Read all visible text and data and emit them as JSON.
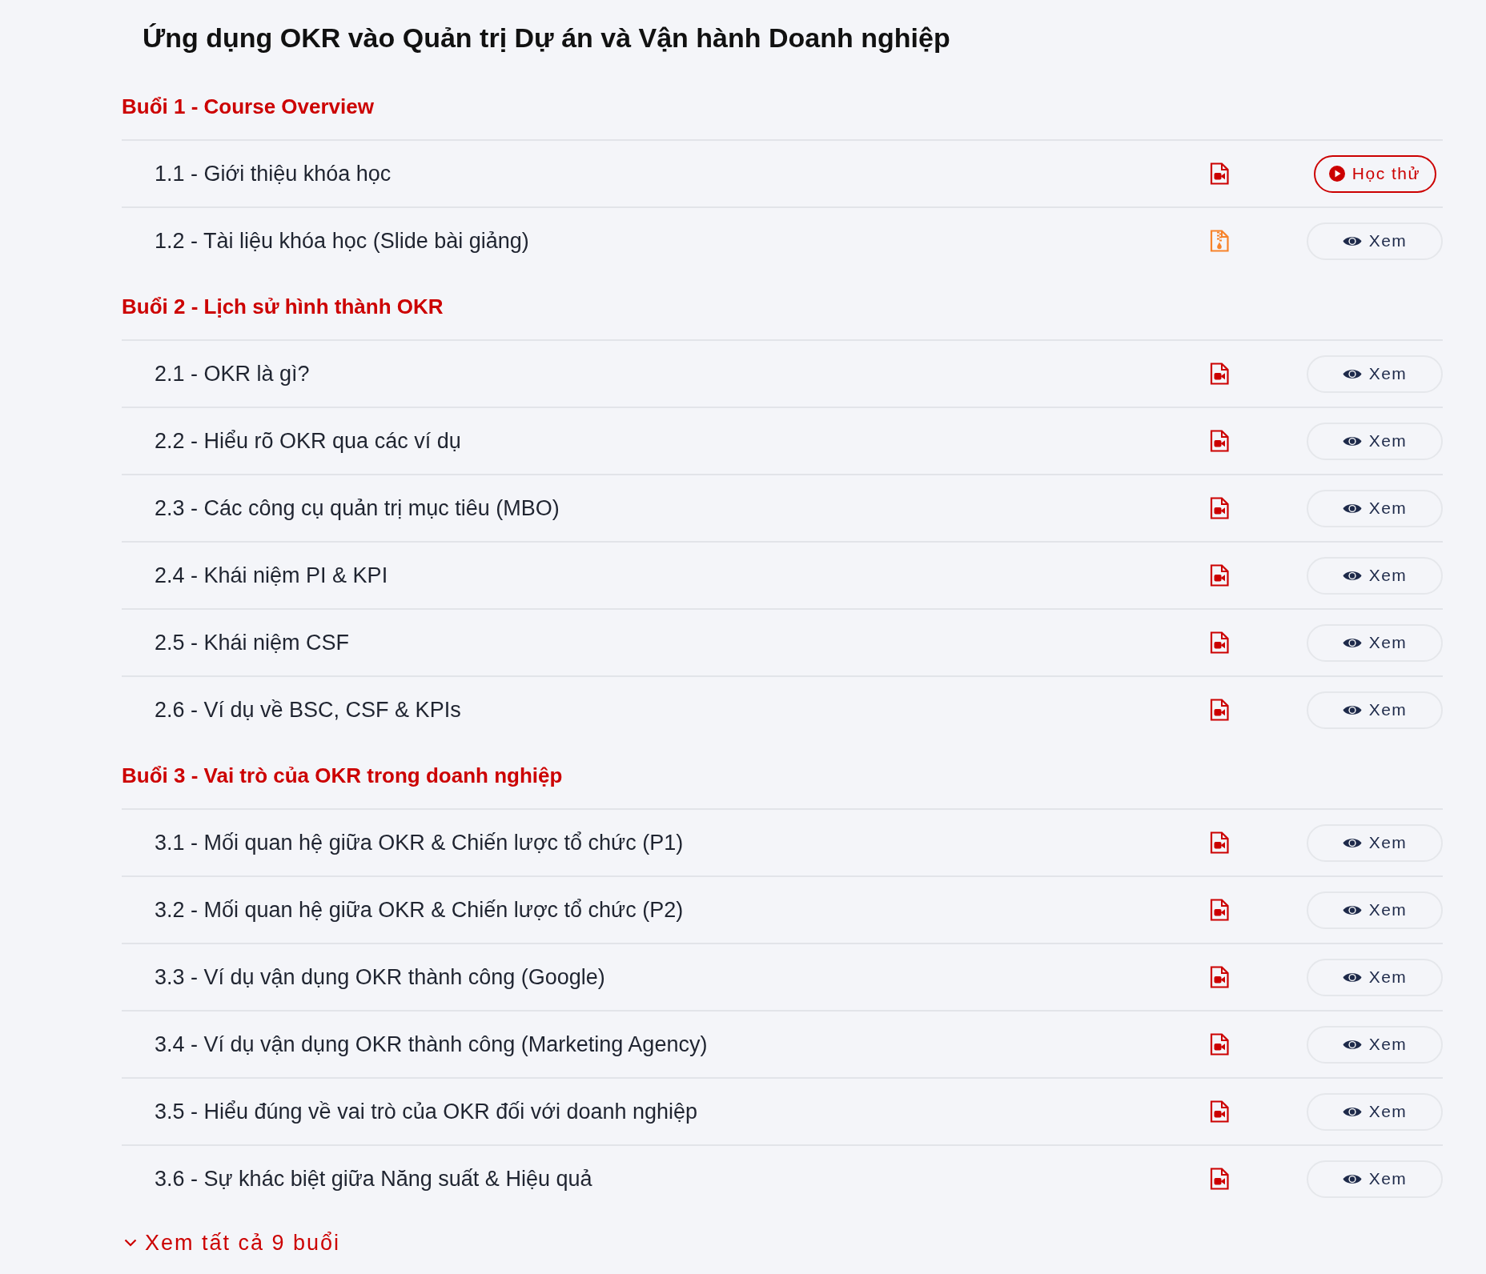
{
  "page_title": "Ứng dụng OKR vào Quản trị Dự án và Vận hành Doanh nghiệp",
  "sections": [
    {
      "title": "Buổi 1 - Course Overview",
      "lessons": [
        {
          "title": "1.1 - Giới thiệu khóa học",
          "kind": "video",
          "button": {
            "kind": "trial",
            "label": "Học thử"
          }
        },
        {
          "title": "1.2 - Tài liệu khóa học (Slide bài giảng)",
          "kind": "archive",
          "button": {
            "kind": "view",
            "label": "Xem"
          }
        }
      ]
    },
    {
      "title": "Buổi 2 - Lịch sử hình thành OKR",
      "lessons": [
        {
          "title": "2.1 - OKR là gì?",
          "kind": "video",
          "button": {
            "kind": "view",
            "label": "Xem"
          }
        },
        {
          "title": "2.2 - Hiểu rõ OKR qua các ví dụ",
          "kind": "video",
          "button": {
            "kind": "view",
            "label": "Xem"
          }
        },
        {
          "title": "2.3 - Các công cụ quản trị mục tiêu (MBO)",
          "kind": "video",
          "button": {
            "kind": "view",
            "label": "Xem"
          }
        },
        {
          "title": "2.4 - Khái niệm PI & KPI",
          "kind": "video",
          "button": {
            "kind": "view",
            "label": "Xem"
          }
        },
        {
          "title": "2.5 - Khái niệm CSF",
          "kind": "video",
          "button": {
            "kind": "view",
            "label": "Xem"
          }
        },
        {
          "title": "2.6 - Ví dụ về BSC, CSF & KPIs",
          "kind": "video",
          "button": {
            "kind": "view",
            "label": "Xem"
          }
        }
      ]
    },
    {
      "title": "Buổi 3 - Vai trò của OKR trong doanh nghiệp",
      "lessons": [
        {
          "title": "3.1 - Mối quan hệ giữa OKR & Chiến lược tổ chức (P1)",
          "kind": "video",
          "button": {
            "kind": "view",
            "label": "Xem"
          }
        },
        {
          "title": "3.2 - Mối quan hệ giữa OKR & Chiến lược tổ chức (P2)",
          "kind": "video",
          "button": {
            "kind": "view",
            "label": "Xem"
          }
        },
        {
          "title": "3.3 - Ví dụ vận dụng OKR thành công (Google)",
          "kind": "video",
          "button": {
            "kind": "view",
            "label": "Xem"
          }
        },
        {
          "title": "3.4 - Ví dụ vận dụng OKR thành công (Marketing Agency)",
          "kind": "video",
          "button": {
            "kind": "view",
            "label": "Xem"
          }
        },
        {
          "title": "3.5 - Hiểu đúng về vai trò của OKR đối với doanh nghiệp",
          "kind": "video",
          "button": {
            "kind": "view",
            "label": "Xem"
          }
        },
        {
          "title": "3.6 - Sự khác biệt giữa Năng suất & Hiệu quả",
          "kind": "video",
          "button": {
            "kind": "view",
            "label": "Xem"
          }
        }
      ]
    }
  ],
  "show_all": {
    "label": "Xem tất cả 9 buổi"
  }
}
